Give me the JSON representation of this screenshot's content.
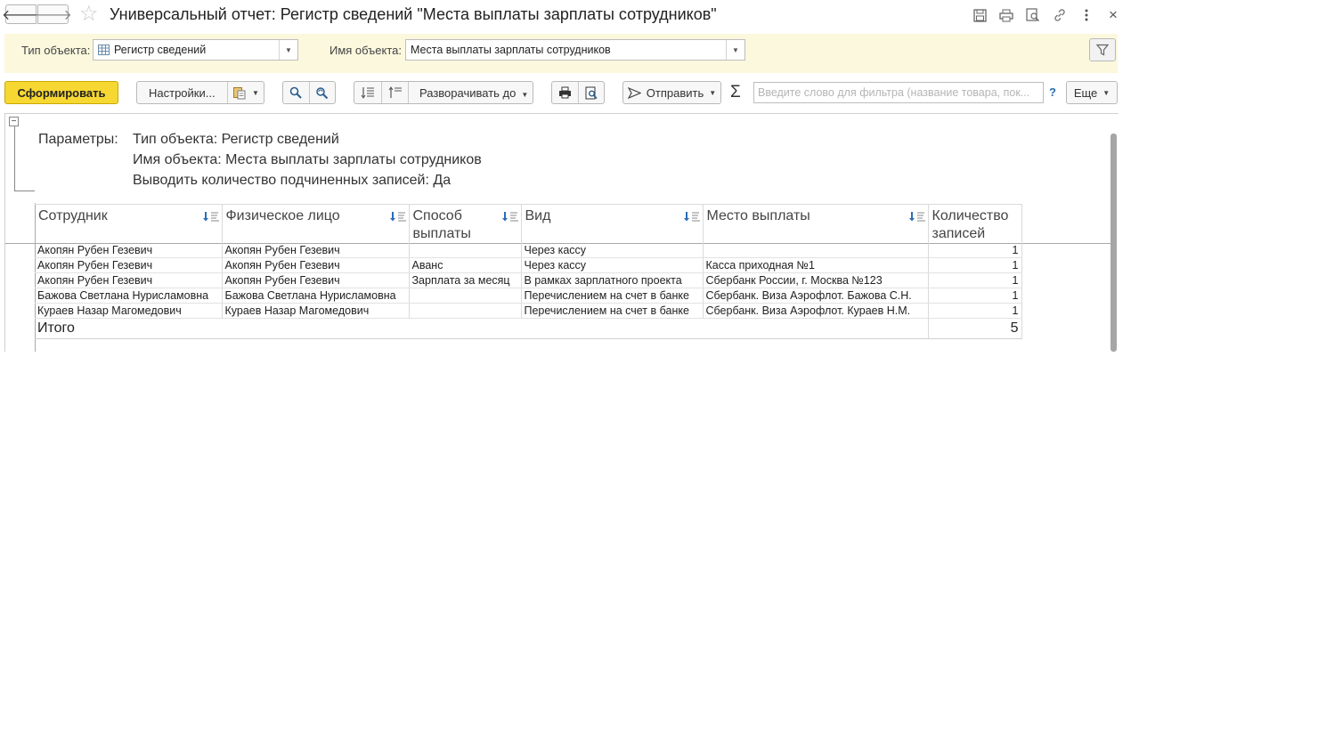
{
  "window": {
    "title": "Универсальный отчет: Регистр сведений \"Места выплаты зарплаты сотрудников\"",
    "nav_back": "🡐",
    "nav_forward": "🡒",
    "star": "☆",
    "close": "×",
    "icons": [
      "save-icon",
      "print-icon",
      "preview-icon",
      "link-icon",
      "more-vertical-icon",
      "close-icon"
    ]
  },
  "params": {
    "object_type_label": "Тип объекта:",
    "object_type_value": "Регистр сведений",
    "object_name_label": "Имя объекта:",
    "object_name_value": "Места выплаты зарплаты сотрудников"
  },
  "toolbar": {
    "generate": "Сформировать",
    "settings": "Настройки...",
    "expand_to": "Разворачивать до",
    "send": "Отправить",
    "sigma": "Σ",
    "filter_placeholder": "Введите слово для фильтра (название товара, пок...",
    "help": "?",
    "more": "Еще"
  },
  "report": {
    "params_title": "Параметры:",
    "param_lines": [
      "Тип объекта: Регистр сведений",
      "Имя объекта: Места выплаты зарплаты сотрудников",
      "Выводить количество подчиненных записей: Да"
    ],
    "columns": [
      {
        "title": "Сотрудник",
        "subtitle": ""
      },
      {
        "title": "Физическое лицо",
        "subtitle": ""
      },
      {
        "title": "Способ",
        "subtitle": "выплаты"
      },
      {
        "title": "Вид",
        "subtitle": ""
      },
      {
        "title": "Место выплаты",
        "subtitle": ""
      },
      {
        "title": "Количество",
        "subtitle": "записей"
      }
    ],
    "rows": [
      [
        "Акопян Рубен Гезевич",
        "Акопян Рубен Гезевич",
        "",
        "Через кассу",
        "",
        "1"
      ],
      [
        "Акопян Рубен Гезевич",
        "Акопян Рубен Гезевич",
        "Аванс",
        "Через кассу",
        "Касса приходная №1",
        "1"
      ],
      [
        "Акопян Рубен Гезевич",
        "Акопян Рубен Гезевич",
        "Зарплата за месяц",
        "В рамках зарплатного проекта",
        "Сбербанк России, г. Москва №123",
        "1"
      ],
      [
        "Бажова Светлана Нурисламовна",
        "Бажова Светлана Нурисламовна",
        "",
        "Перечислением на счет в банке",
        "Сбербанк. Виза Аэрофлот. Бажова С.Н.",
        "1"
      ],
      [
        "Кураев Назар Магомедович",
        "Кураев Назар Магомедович",
        "",
        "Перечислением на счет в банке",
        "Сбербанк. Виза Аэрофлот. Кураев Н.М.",
        "1"
      ]
    ],
    "total_label": "Итого",
    "total_value": "5"
  },
  "colors": {
    "accent_button": "#f7d732",
    "params_background": "#fbf8dd",
    "sort_icon": "#2a6db5"
  }
}
